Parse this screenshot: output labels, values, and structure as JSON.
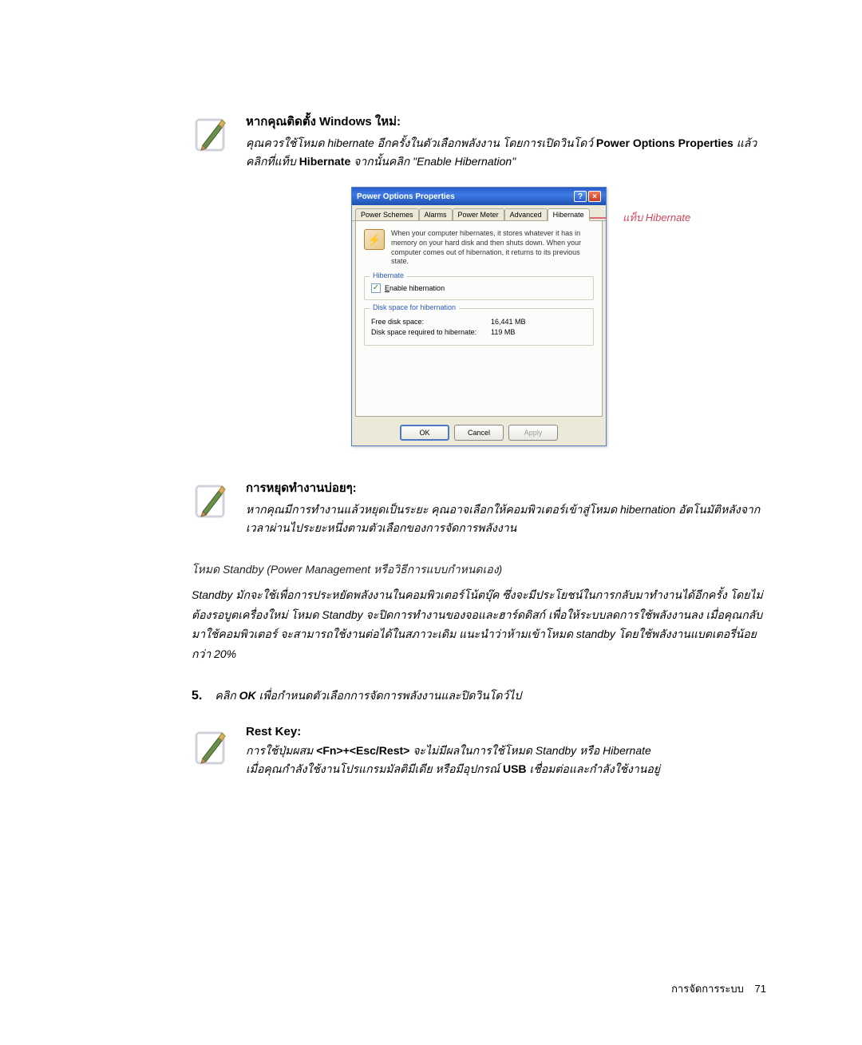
{
  "notes": {
    "install": {
      "title": "หากคุณติดตั้ง Windows ใหม่:",
      "body_prefix": "คุณควรใช้โหมด hibernate อีกครั้งในตัวเลือกพลังงาน โดยการเปิดวินโดว์ ",
      "bold1": "Power Options Properties",
      "body_mid": " แล้วคลิกที่แท็บ ",
      "bold2": "Hibernate",
      "body_suffix": " จากนั้นคลิก \"Enable Hibernation\""
    },
    "frequent": {
      "title": "การหยุดทำงานบ่อยๆ:",
      "body": "หากคุณมีการทำงานแล้วหยุดเป็นระยะ คุณอาจเลือกให้คอมพิวเตอร์เข้าสู่โหมด hibernation อัตโนมัติหลังจากเวลาผ่านไประยะหนึ่งตามตัวเลือกของการจัดการพลังงาน"
    },
    "restkey": {
      "title": "Rest Key:",
      "line1_prefix": "การใช้ปุ่มผสม ",
      "line1_key": "<Fn>+<Esc/Rest>",
      "line1_suffix": " จะไม่มีผลในการใช้โหมด Standby หรือ Hibernate",
      "line2_prefix": "เมื่อคุณกำลังใช้งานโปรแกรมมัลติมีเดีย หรือมีอุปกรณ์ ",
      "line2_bold": "USB",
      "line2_suffix": " เชื่อมต่อและกำลังใช้งานอยู่"
    }
  },
  "dialog": {
    "title": "Power Options Properties",
    "tabs": [
      "Power Schemes",
      "Alarms",
      "Power Meter",
      "Advanced",
      "Hibernate"
    ],
    "info": "When your computer hibernates, it stores whatever it has in memory on your hard disk and then shuts down. When your computer comes out of hibernation, it returns to its previous state.",
    "group1_title": "Hibernate",
    "checkbox_label": "Enable hibernation",
    "group2_title": "Disk space for hibernation",
    "free_label": "Free disk space:",
    "free_value": "16,441 MB",
    "req_label": "Disk space required to hibernate:",
    "req_value": "119 MB",
    "ok": "OK",
    "cancel": "Cancel",
    "apply": "Apply",
    "callout_label": "แท็บ Hibernate"
  },
  "standby": {
    "heading": "โหมด Standby (Power Management หรือวิธีการแบบกำหนดเอง)",
    "body": "Standby มักจะใช้เพื่อการประหยัดพลังงานในคอมพิวเตอร์โน้ตบุ๊ค ซึ่งจะมีประโยชน์ในการกลับมาทำงานได้อีกครั้ง โดยไม่ต้องรอบูตเครื่องใหม่ โหมด Standby จะปิดการทำงานของจอและฮาร์ดดิสก์ เพื่อให้ระบบลดการใช้พลังงานลง เมื่อคุณกลับมาใช้คอมพิวเตอร์ จะสามารถใช้งานต่อได้ในสภาวะเดิม แนะนำว่าห้ามเข้าโหมด standby โดยใช้พลังงานแบตเตอรี่น้อยกว่า 20%"
  },
  "step5": {
    "num": "5.",
    "text_prefix": "คลิก ",
    "text_bold": "OK",
    "text_suffix": " เพื่อกำหนดตัวเลือกการจัดการพลังงานและปิดวินโดว์ไป"
  },
  "footer": {
    "section": "การจัดการระบบ",
    "page": "71"
  }
}
